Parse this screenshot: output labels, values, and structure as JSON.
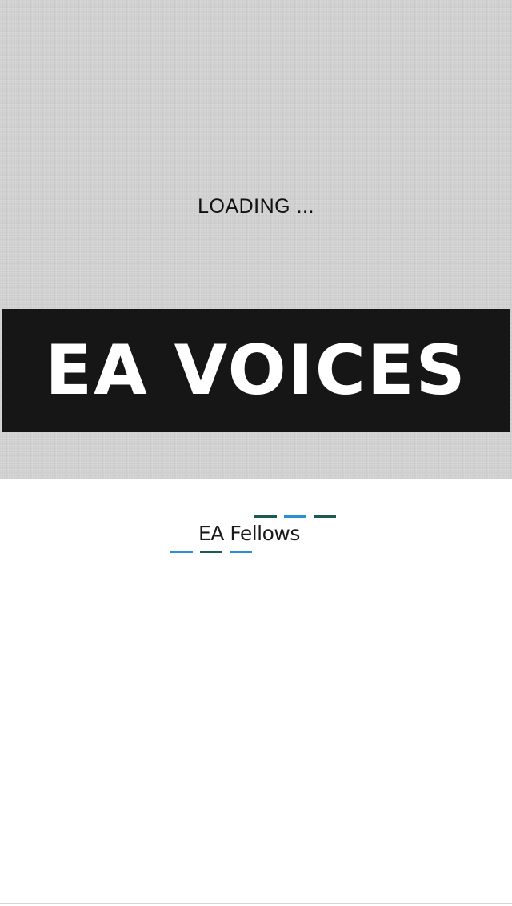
{
  "splash": {
    "loading_text": "LOADING ...",
    "banner_title": "EA VOICES",
    "background_color": "#cfcfcf",
    "banner_color": "#161616"
  },
  "logo": {
    "text": "EA Fellows",
    "colors": {
      "teal": "#1e5a4f",
      "blue": "#2a8fd4"
    }
  }
}
